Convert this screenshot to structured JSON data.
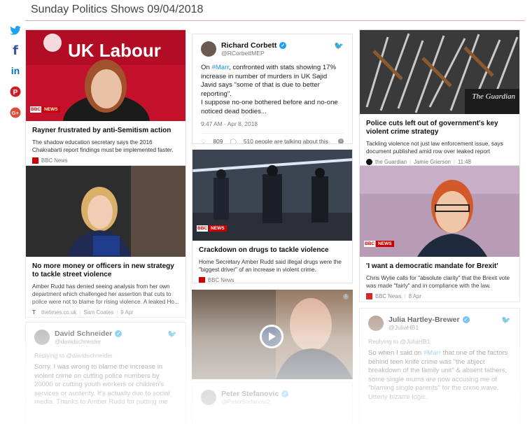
{
  "header": {
    "title": "Sunday Politics Shows 09/04/2018"
  },
  "social": [
    {
      "name": "twitter-icon",
      "glyph": "🐦",
      "color": "#1da1f2"
    },
    {
      "name": "facebook-icon",
      "glyph": "f",
      "color": "#3b5998"
    },
    {
      "name": "linkedin-icon",
      "glyph": "in",
      "color": "#0077b5"
    },
    {
      "name": "pinterest-icon",
      "glyph": "P",
      "color": "#cb2027"
    },
    {
      "name": "google-plus-icon",
      "glyph": "G+",
      "color": "#dd4b39"
    }
  ],
  "col1": {
    "card1": {
      "image_banner": "UK Labour",
      "badge": {
        "bbc": "BBC",
        "news": "NEWS"
      },
      "title": "Rayner frustrated by anti-Semitism action",
      "desc": "The shadow education secretary says the 2016 Chakrabarti report findings must be implemented faster.",
      "source": "BBC News"
    },
    "card2": {
      "title": "No more money or officers in new strategy to tackle street violence",
      "desc": "Amber Rudd has denied seeing analysis from her own department which challenged her assertion that cuts to police were not to blame for rising violence. A leaked Ho...",
      "source": "thetimes.co.uk",
      "author": "Sam Coates",
      "date": "9 Apr"
    },
    "tweet": {
      "name": "David Schneider",
      "handle": "@davidschneider",
      "reply": "Replying to @davidschneider",
      "body": "Sorry. I was wrong to blame the increase in violent crime on cutting police numbers by 20000 or cutting youth workers or children's services or austerity. It's actually due to social media. Thanks to Amber Rudd for putting me"
    }
  },
  "col2": {
    "tweet": {
      "name": "Richard Corbett",
      "handle": "@RCorbettMEP",
      "body_pre": "On ",
      "hashtag": "#Marr",
      "body_post": ", confronted with stats showing 17% increase in number of murders in UK Sajid Javid says \"some  of that is due to better reporting\".",
      "body_2": "I suppose no-one bothered before and no-one noticed dead bodies...",
      "time": "9:47 AM - Apr 8, 2018",
      "likes": "809",
      "talking": "510 people are talking about this"
    },
    "card": {
      "badge": {
        "bbc": "BBC",
        "news": "NEWS"
      },
      "title": "Crackdown on drugs to tackle violence",
      "desc": "Home Secretary Amber Rudd said illegal drugs were the \"biggest driver\" of an increase in violent crime.",
      "source": "BBC News"
    },
    "tweet2": {
      "name": "Peter Stefanovic",
      "handle": "@PeterStefanovi2"
    }
  },
  "col3": {
    "card1": {
      "image_label": "The Guardian",
      "title": "Police cuts left out of government's key violent crime strategy",
      "desc": "Tackling violence not just law enforcement issue, says document published amid row over leaked report",
      "source": "the Guardian",
      "author": "Jamie Grierson",
      "date": "11:48"
    },
    "card2": {
      "badge": {
        "bbc": "BBC",
        "news": "NEWS"
      },
      "title": "'I want a democratic mandate for Brexit'",
      "desc": "Chris Wylie calls for \"absolute clarity\" that the Brexit vote was made \"fairly\" and in compliance with the law.",
      "source": "BBC News",
      "date": "8 Apr"
    },
    "tweet": {
      "name": "Julia Hartley-Brewer",
      "handle": "@JuliaHB1",
      "reply": "Replying to @JuliaHB1",
      "body_pre": "So when I said on ",
      "hashtag": "#Marr",
      "body_post": " that one of the factors behind teen knife crime was \"the abject breakdown of the family unit\" & absent fathers, some single mums are now accusing me of \"blaming single parents\" for the crime wave. Utterly bizarre logic."
    }
  }
}
